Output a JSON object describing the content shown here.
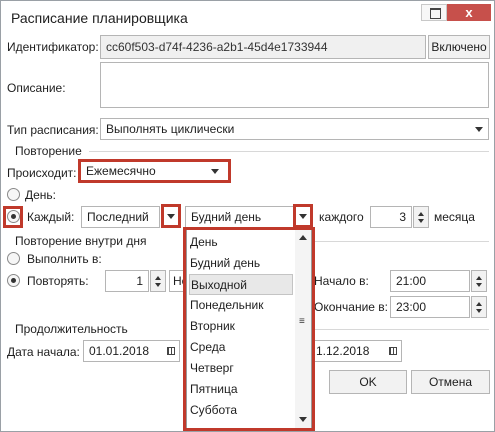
{
  "window": {
    "title": "Расписание планировщика",
    "close_label": "x"
  },
  "identifier": {
    "label": "Идентификатор:",
    "value": "cc60f503-d74f-4236-a2b1-45d4e1733944",
    "toggle_label": "Включено"
  },
  "description": {
    "label": "Описание:",
    "value": ""
  },
  "schedule_type": {
    "label": "Тип расписания:",
    "value": "Выполнять циклически"
  },
  "repeat": {
    "section_title": "Повторение",
    "occurs_label": "Происходит:",
    "occurs_value": "Ежемесячно",
    "day_label": "День:",
    "each_label": "Каждый:",
    "each_value": "Последний",
    "weekday_value": "Будний день",
    "every_label": "каждого",
    "every_value": "3",
    "month_label": "месяца"
  },
  "daily": {
    "section_title": "Повторение внутри дня",
    "run_at_label": "Выполнить в:",
    "repeat_label": "Повторять:",
    "repeat_value": "1",
    "repeat_unit_partial": "Не",
    "start_label": "Начало в:",
    "start_value": "21:00",
    "end_label": "Окончание в:",
    "end_value": "23:00"
  },
  "duration": {
    "section_title": "Продолжительность",
    "start_date_label": "Дата начала:",
    "start_date_value": "01.01.2018",
    "end_date_value": "1.12.2018"
  },
  "dropdown": {
    "items": [
      "День",
      "Будний день",
      "Выходной",
      "Понедельник",
      "Вторник",
      "Среда",
      "Четверг",
      "Пятница",
      "Суббота"
    ],
    "selected_index": 2
  },
  "buttons": {
    "ok": "OK",
    "cancel": "Отмена"
  },
  "colors": {
    "highlight": "#c0392b",
    "close_button": "#c7504b"
  }
}
